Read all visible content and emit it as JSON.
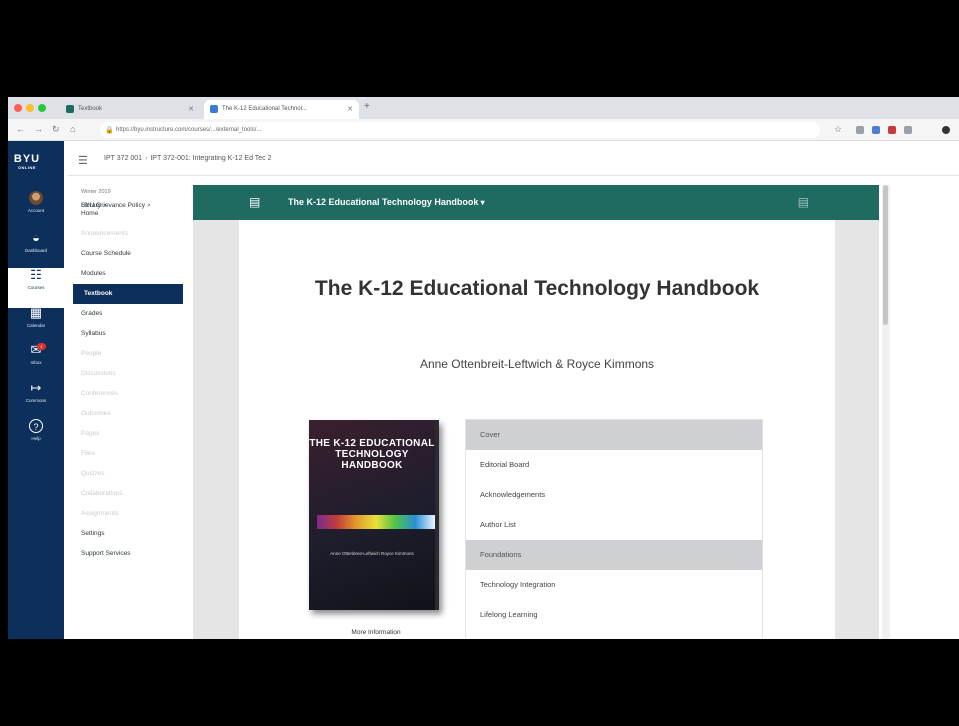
{
  "browser": {
    "tabs": [
      {
        "label": "Textbook",
        "icon_color": "#1f6b62"
      },
      {
        "label": "The K-12 Educational Technol...",
        "icon_color": "#3b7bd4"
      }
    ],
    "new_tab": "+",
    "url": "https://byu.instructure.com/courses/.../external_tools/...",
    "extension_colors": [
      "#9aa0a6",
      "#9aa0a6",
      "#4a7fd6",
      "#c83a3a",
      "#9aa0a6",
      "#333333"
    ]
  },
  "global_nav": {
    "logo_big": "BYU",
    "logo_small": "ONLINE",
    "items": [
      {
        "label": "Account",
        "icon": "avatar"
      },
      {
        "label": "Dashboard",
        "icon": "dashboard-icon",
        "glyph": "◒"
      },
      {
        "label": "Courses",
        "icon": "courses-icon",
        "glyph": "☷"
      },
      {
        "label": "Calendar",
        "icon": "calendar-icon",
        "glyph": "▦"
      },
      {
        "label": "Inbox",
        "icon": "inbox-icon",
        "glyph": "✉",
        "badge": "1"
      },
      {
        "label": "Commons",
        "icon": "commons-icon",
        "glyph": "↦"
      },
      {
        "label": "Help",
        "icon": "help-icon",
        "glyph": "?"
      }
    ]
  },
  "breadcrumb": {
    "course": "IPT 372 001",
    "page": "IPT 372-001: Integrating K-12 Ed Tec 2"
  },
  "course_nav": {
    "term": "Winter 2019",
    "items": [
      {
        "label": "Home",
        "state": "normal"
      },
      {
        "label": "Announcements",
        "state": "dim"
      },
      {
        "label": "Course Schedule",
        "state": "normal"
      },
      {
        "label": "Modules",
        "state": "normal"
      },
      {
        "label": "Textbook",
        "state": "active"
      },
      {
        "label": "Grades",
        "state": "normal"
      },
      {
        "label": "Syllabus",
        "state": "normal"
      },
      {
        "label": "People",
        "state": "dim"
      },
      {
        "label": "Discussions",
        "state": "dim"
      },
      {
        "label": "Conferences",
        "state": "dim"
      },
      {
        "label": "Outcomes",
        "state": "dim"
      },
      {
        "label": "Pages",
        "state": "dim"
      },
      {
        "label": "Files",
        "state": "dim"
      },
      {
        "label": "Quizzes",
        "state": "dim"
      },
      {
        "label": "Collaborations",
        "state": "dim"
      },
      {
        "label": "Assignments",
        "state": "dim"
      },
      {
        "label": "Settings",
        "state": "normal"
      },
      {
        "label": "Library",
        "state": "ext"
      },
      {
        "label": "BYU Grievance Policy",
        "state": "ext"
      },
      {
        "label": "Support Services",
        "state": "normal"
      }
    ]
  },
  "pressbooks": {
    "bar_title": "The K-12 Educational Technology Handbook",
    "book_title": "The K-12 Educational Technology Handbook",
    "authors": "Anne Ottenbreit-Leftwich & Royce Kimmons",
    "cover": {
      "title": "THE K-12 EDUCATIONAL TECHNOLOGY HANDBOOK",
      "authors": "Anne Ottenbreit-Leftwich Royce Kimmons"
    },
    "more_info": "More Information",
    "toc": [
      {
        "label": "Cover",
        "head": true
      },
      {
        "label": "Editorial Board",
        "head": false
      },
      {
        "label": "Acknowledgements",
        "head": false
      },
      {
        "label": "Author List",
        "head": false
      },
      {
        "label": "Foundations",
        "head": true
      },
      {
        "label": "Technology Integration",
        "head": false
      },
      {
        "label": "Lifelong Learning",
        "head": false
      },
      {
        "label": "",
        "head": false
      }
    ]
  },
  "colors": {
    "canvas_nav": "#0d2f5c",
    "pressbooks_bar": "#1f6b62"
  }
}
